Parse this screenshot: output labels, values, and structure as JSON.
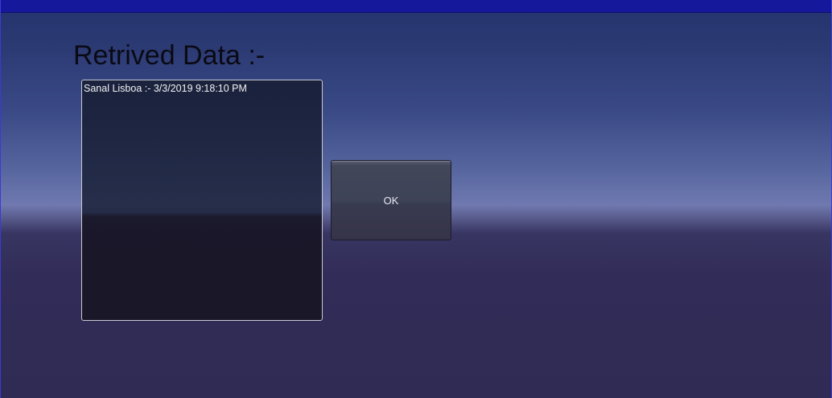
{
  "window": {
    "title": "Retrived Data :-"
  },
  "data_box": {
    "entries": [
      "Sanal Lisboa :- 3/3/2019 9:18:10 PM"
    ]
  },
  "ok_button": {
    "label": "OK"
  },
  "colors": {
    "top_bar": "#15189a",
    "title_text": "#0a0a14",
    "button_bg": "#3e4357",
    "box_border": "#c8c8d0"
  }
}
